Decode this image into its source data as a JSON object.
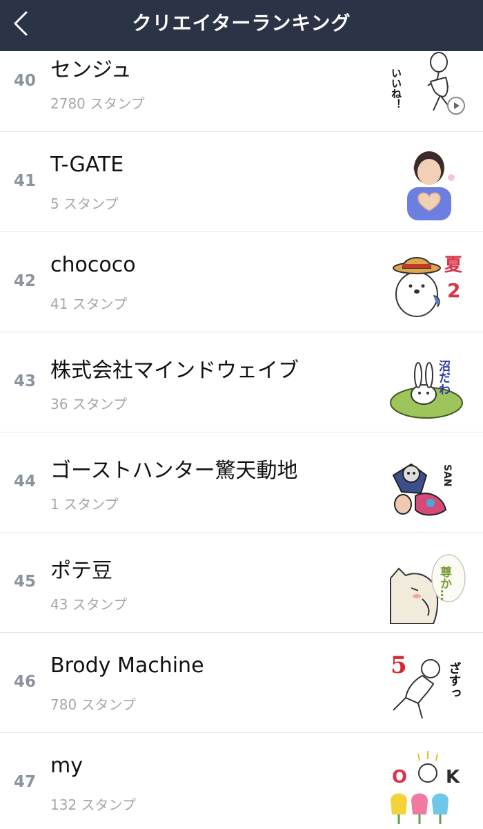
{
  "header": {
    "title": "クリエイターランキング"
  },
  "items": [
    {
      "rank": "40",
      "name": "センジュ",
      "count": "2780 スタンプ",
      "thumb_icon": "sticker-man-thumbnail"
    },
    {
      "rank": "41",
      "name": "T-GATE",
      "count": "5 スタンプ",
      "thumb_icon": "sticker-heart-boy-thumbnail"
    },
    {
      "rank": "42",
      "name": "chococo",
      "count": "41 スタンプ",
      "thumb_icon": "sticker-seal-hat-thumbnail"
    },
    {
      "rank": "43",
      "name": "株式会社マインドウェイブ",
      "count": "36 スタンプ",
      "thumb_icon": "sticker-rabbit-swamp-thumbnail"
    },
    {
      "rank": "44",
      "name": "ゴーストハンター驚天動地",
      "count": "1 スタンプ",
      "thumb_icon": "sticker-ghost-hunter-thumbnail"
    },
    {
      "rank": "45",
      "name": "ポテ豆",
      "count": "43 スタンプ",
      "thumb_icon": "sticker-cat-thumbnail"
    },
    {
      "rank": "46",
      "name": "Brody Machine",
      "count": "780 スタンプ",
      "thumb_icon": "sticker-bear-kick-thumbnail"
    },
    {
      "rank": "47",
      "name": "my",
      "count": "132 スタンプ",
      "thumb_icon": "sticker-ok-tulips-thumbnail"
    }
  ],
  "thumb_text": {
    "t40": "いいね！",
    "t42_a": "夏",
    "t42_b": "2",
    "t43": "沼だわ",
    "t44": "SAN",
    "t45": "尊か…",
    "t46_a": "5",
    "t46_b": "ざすっ",
    "t47_a": "O",
    "t47_b": "K"
  },
  "colors": {
    "navbar": "#2b3447",
    "rank": "#8c93a0",
    "count": "#a6a6a6",
    "divider": "#e8e8ea"
  }
}
